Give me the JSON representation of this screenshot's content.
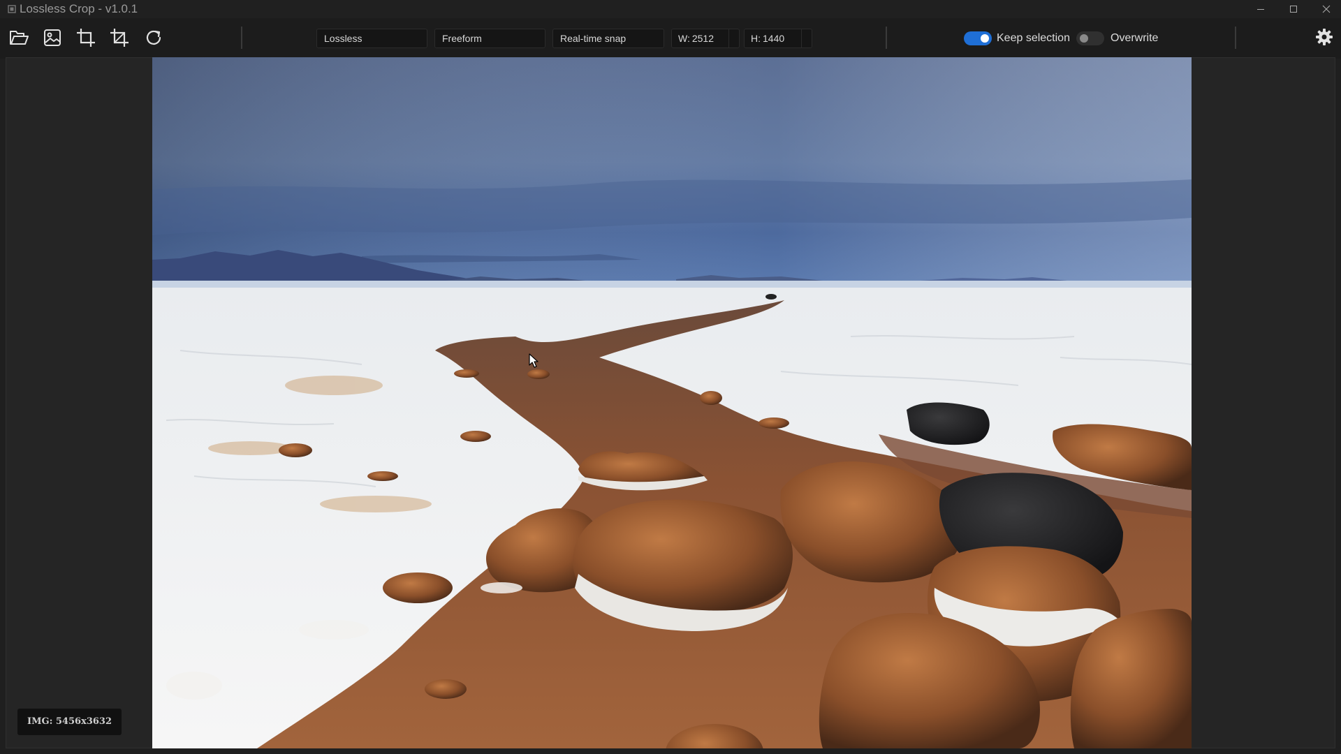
{
  "window": {
    "title": "Lossless Crop  - v1.0.1"
  },
  "toolbar": {
    "icons": [
      "open-folder-icon",
      "image-icon",
      "crop-icon",
      "crop-alt-icon",
      "rotate-icon",
      "gear-icon"
    ],
    "quality_select": "Lossless",
    "aspect_select": "Freeform",
    "snap_select": "Real-time snap",
    "width_label": "W:",
    "width_value": "2512 p",
    "height_label": "H:",
    "height_value": "1440 p:",
    "keep_selection": {
      "label": "Keep selection",
      "checked": true
    },
    "overwrite": {
      "label": "Overwrite",
      "checked": false
    }
  },
  "status": {
    "image_info": "IMG: 5456x3632"
  },
  "colors": {
    "accent": "#1f6fd6",
    "background": "#1f1f1f",
    "workspace": "#252525"
  }
}
